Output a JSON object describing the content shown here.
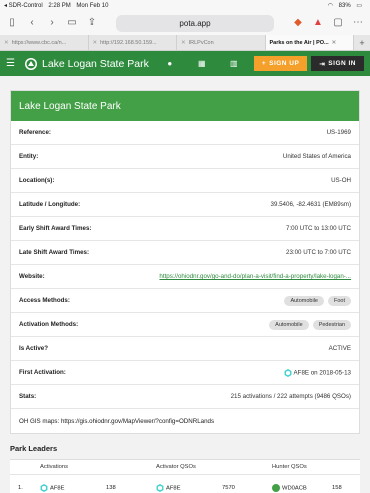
{
  "status_bar": {
    "back_app": "◂ SDR-Control",
    "time": "2:28 PM",
    "date": "Mon Feb 10",
    "battery": "83%"
  },
  "browser": {
    "url": "pota.app",
    "tabs": [
      {
        "label": "https://www.cbc.ca/n..."
      },
      {
        "label": "http://192.168.50.159..."
      },
      {
        "label": "IRLPvCon"
      },
      {
        "label": "Parks on the Air | PO..."
      }
    ]
  },
  "nav": {
    "title": "Lake Logan State Park",
    "signup_label": "SIGN UP",
    "signin_label": "SIGN IN"
  },
  "park": {
    "header": "Lake Logan State Park",
    "rows": [
      {
        "key": "Reference:",
        "value": "US-1969"
      },
      {
        "key": "Entity:",
        "value": "United States of America"
      },
      {
        "key": "Location(s):",
        "value": "US-OH"
      },
      {
        "key": "Latitude / Longitude:",
        "value": "39.5406, -82.4631 (EM89sm)"
      },
      {
        "key": "Early Shift Award Times:",
        "value": "7:00 UTC to 13:00 UTC"
      },
      {
        "key": "Late Shift Award Times:",
        "value": "23:00 UTC to 7:00 UTC"
      },
      {
        "key": "Website:",
        "value": "https://ohiodnr.gov/go-and-do/plan-a-visit/find-a-property/lake-logan-..."
      }
    ],
    "access_label": "Access Methods:",
    "access_methods": [
      "Automobile",
      "Foot"
    ],
    "activation_label": "Activation Methods:",
    "activation_methods": [
      "Automobile",
      "Pedestrian"
    ],
    "active_label": "Is Active?",
    "active_value": "ACTIVE",
    "first_activation_label": "First Activation:",
    "first_activation_value": "AF8E on 2018-05-13",
    "stats_label": "Stats:",
    "stats_value": "215 activations / 222 attempts (9486 QSOs)",
    "gis": "OH GIS maps: https://gis.ohiodnr.gov/MapViewer/?config=ODNRLands"
  },
  "leaders": {
    "title": "Park Leaders",
    "headers": {
      "activations": "Activations",
      "activator_qsos": "Activator QSOs",
      "hunter_qsos": "Hunter QSOs"
    },
    "rows": [
      {
        "rank": "1.",
        "act_call": "AF8E",
        "act_count": "138",
        "aq_call": "AF8E",
        "aq_count": "7570",
        "hq_call": "WD0ACB",
        "hq_count": "158"
      }
    ]
  },
  "colors": {
    "nav_green": "#2e8b3e",
    "header_green": "#43a047",
    "signup_orange": "#f4a02a",
    "signin_dark": "#2b2b2b"
  }
}
